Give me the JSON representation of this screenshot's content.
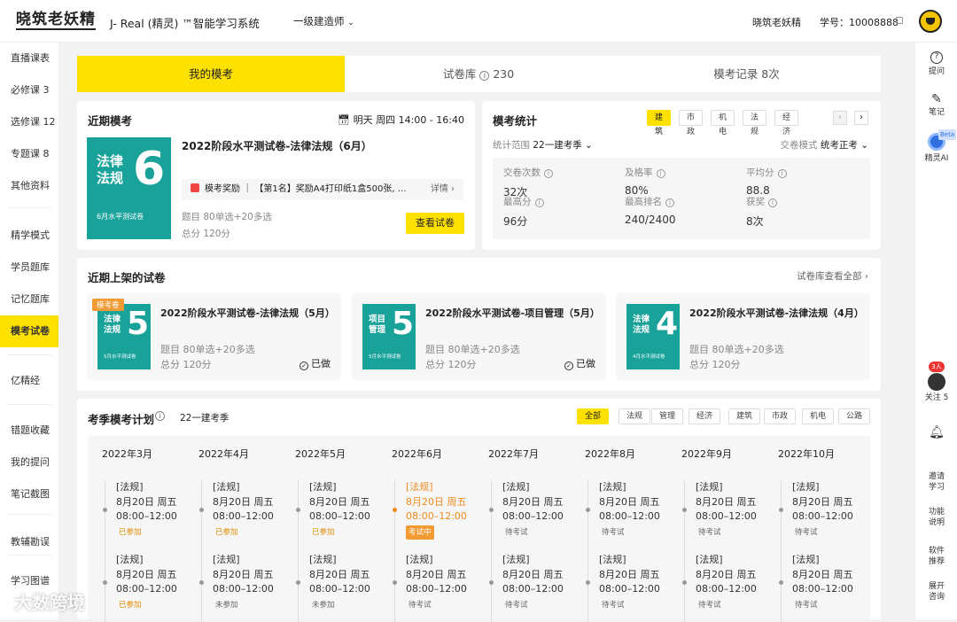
{
  "header": {
    "logo": "晓筑老妖精",
    "system": "J- Real (精灵) ™智能学习系统",
    "role": "一级建造师",
    "user": "晓筑老妖精",
    "student_id": "学号：10008888"
  },
  "left_nav": [
    "直播课表",
    "必修课 3",
    "选修课 12",
    "专题课 8",
    "其他资料",
    "精学模式",
    "学员题库",
    "记忆题库",
    "模考试卷",
    "亿精经",
    "错题收藏",
    "我的提问",
    "笔记截图",
    "教辅勘误",
    "学习图谱"
  ],
  "left_nav_active": "模考试卷",
  "right_nav": {
    "ask": "提问",
    "note": "笔记",
    "ai": "精灵AI",
    "beta": "Beta",
    "follow_badge": "3人",
    "follow": "关注 5",
    "invite": "邀请学习",
    "features": "功能说明",
    "software": "软件推荐",
    "expand": "展开咨询"
  },
  "tabs": {
    "mine": "我的模考",
    "bank_label": "试卷库",
    "bank_count": "230",
    "records": "模考记录 8次"
  },
  "recent": {
    "title": "近期模考",
    "time": "明天  周四  14:00 - 16:40",
    "paper_title": "2022阶段水平测试卷-法律法规（6月）",
    "reward": "模考奖励 ｜ 【第1名】奖励A4打印纸1盒500张, …",
    "reward_detail": "详情",
    "meta1": "题目   80单选+20多选",
    "meta2": "总分   120分",
    "cta": "查看试卷",
    "cover": {
      "line1": "法律",
      "line2": "法规",
      "num": "6",
      "sub": "6月水平测试卷"
    }
  },
  "stats": {
    "title": "模考统计",
    "chips": [
      "建筑",
      "市政",
      "机电",
      "法规",
      "经济"
    ],
    "range_label": "统计范围",
    "range": "22一建考季",
    "mode_label": "交卷模式",
    "mode": "统考正考",
    "items": [
      {
        "l": "交卷次数",
        "v": "32次"
      },
      {
        "l": "及格率",
        "v": "80%"
      },
      {
        "l": "平均分",
        "v": "88.8"
      },
      {
        "l": "最高分",
        "v": "96分"
      },
      {
        "l": "最高排名",
        "v": "240/2400"
      },
      {
        "l": "获奖",
        "v": "8次"
      }
    ]
  },
  "new_papers": {
    "title": "近期上架的试卷",
    "more": "试卷库查看全部",
    "items": [
      {
        "tag": "模考卷",
        "c1": "法律",
        "c2": "法规",
        "num": "5",
        "sub": "5月水平测试卷",
        "title": "2022阶段水平测试卷-法律法规（5月）",
        "q": "题目   80单选+20多选",
        "s": "总分   120分",
        "done": "已做"
      },
      {
        "tag": "",
        "c1": "项目",
        "c2": "管理",
        "num": "5",
        "sub": "5月水平测试卷",
        "title": "2022阶段水平测试卷-项目管理（5月）",
        "q": "题目   80单选+20多选",
        "s": "总分   120分",
        "done": "已做"
      },
      {
        "tag": "",
        "c1": "法律",
        "c2": "法规",
        "num": "4",
        "sub": "4月水平测试卷",
        "title": "2022阶段水平测试卷-法律法规（4月）",
        "q": "题目   80单选+20多选",
        "s": "总分   120分",
        "done": ""
      }
    ]
  },
  "plan": {
    "title": "考季模考计划",
    "season": "22一建考季",
    "chips": [
      "全部",
      "法规",
      "管理",
      "经济",
      "建筑",
      "市政",
      "机电",
      "公路"
    ],
    "months": [
      "2022年3月",
      "2022年4月",
      "2022年5月",
      "2022年6月",
      "2022年7月",
      "2022年8月",
      "2022年9月",
      "2022年10月"
    ],
    "row1": [
      "已参加",
      "已参加",
      "已参加",
      "考试中",
      "待考试",
      "待考试",
      "待考试",
      "待考试"
    ],
    "row2": [
      "已参加",
      "未参加",
      "未参加",
      "待考试",
      "待考试",
      "待考试",
      "待考试",
      "待考试"
    ],
    "ev_tag": "[法规]",
    "ev_date": "8月20日 周五",
    "ev_time": "08:00–12:00"
  },
  "watermark": "大数跨境",
  "colors": {
    "accent": "#ffe100",
    "teal": "#18a29a",
    "orange": "#ef8a1f"
  }
}
